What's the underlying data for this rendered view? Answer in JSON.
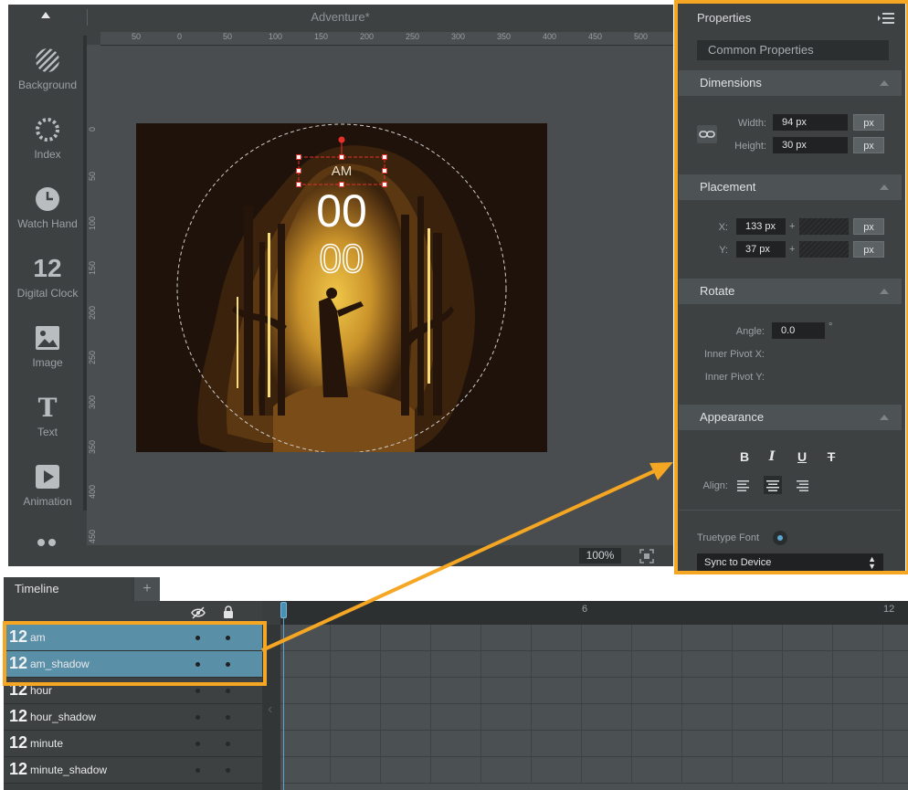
{
  "app": {
    "document_title": "Adventure*",
    "zoom": "100%"
  },
  "sidebar": {
    "tools": [
      {
        "label": "Background",
        "icon": "hatch-circle-icon"
      },
      {
        "label": "Index",
        "icon": "dotted-ring-icon"
      },
      {
        "label": "Watch Hand",
        "icon": "clock-icon"
      },
      {
        "label": "Digital Clock",
        "icon": "digit-12-icon",
        "glyph": "12"
      },
      {
        "label": "Image",
        "icon": "image-icon"
      },
      {
        "label": "Text",
        "icon": "text-icon",
        "glyph": "T"
      },
      {
        "label": "Animation",
        "icon": "play-icon"
      }
    ]
  },
  "ruler": {
    "h_ticks": [
      "50",
      "0",
      "50",
      "100",
      "150",
      "200",
      "250",
      "300",
      "350",
      "400",
      "450",
      "500"
    ],
    "v_ticks": [
      "0",
      "50",
      "100",
      "150",
      "200",
      "250",
      "300",
      "350",
      "400",
      "450"
    ]
  },
  "watchface": {
    "am_text": "AM",
    "hour_text": "00",
    "minute_text": "00"
  },
  "properties": {
    "title": "Properties",
    "common": "Common Properties",
    "dimensions": {
      "title": "Dimensions",
      "width_label": "Width:",
      "width_value": "94 px",
      "height_label": "Height:",
      "height_value": "30 px",
      "unit": "px"
    },
    "placement": {
      "title": "Placement",
      "x_label": "X:",
      "x_value": "133 px",
      "y_label": "Y:",
      "y_value": "37 px",
      "plus": "+",
      "unit": "px"
    },
    "rotate": {
      "title": "Rotate",
      "angle_label": "Angle:",
      "angle_value": "0.0",
      "degree": "°",
      "pivot_x_label": "Inner Pivot X:",
      "pivot_y_label": "Inner Pivot Y:"
    },
    "appearance": {
      "title": "Appearance",
      "bold": "B",
      "italic": "I",
      "underline": "U",
      "strike": "T",
      "align_label": "Align:",
      "truetype_label": "Truetype Font",
      "font_select": "Sync to Device"
    }
  },
  "timeline": {
    "tab": "Timeline",
    "add": "+",
    "frame_labels": [
      "6",
      "12"
    ],
    "layers": [
      {
        "glyph": "12",
        "name": "am",
        "selected": true
      },
      {
        "glyph": "12",
        "name": "am_shadow",
        "selected": true
      },
      {
        "glyph": "12",
        "name": "hour",
        "selected": false
      },
      {
        "glyph": "12",
        "name": "hour_shadow",
        "selected": false
      },
      {
        "glyph": "12",
        "name": "minute",
        "selected": false
      },
      {
        "glyph": "12",
        "name": "minute_shadow",
        "selected": false
      }
    ]
  },
  "colors": {
    "highlight": "#f5a623",
    "selection": "#5a8fa8",
    "panel": "#3d4142"
  }
}
